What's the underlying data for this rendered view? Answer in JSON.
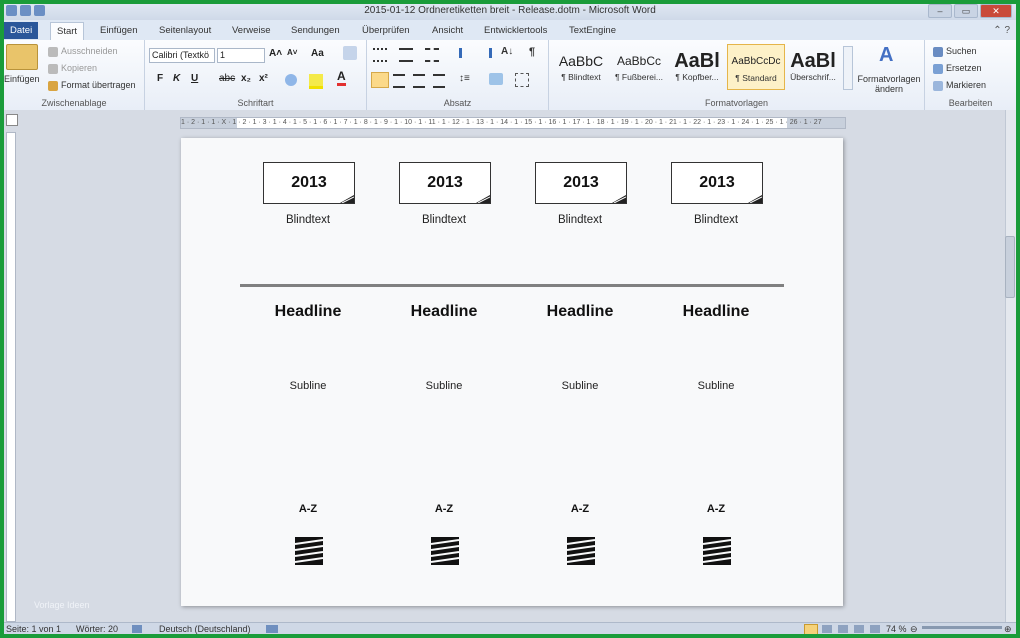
{
  "window": {
    "title": "2015-01-12 Ordneretiketten breit - Release.dotm - Microsoft Word"
  },
  "tabs": [
    {
      "label": "Datei"
    },
    {
      "label": "Start"
    },
    {
      "label": "Einfügen"
    },
    {
      "label": "Seitenlayout"
    },
    {
      "label": "Verweise"
    },
    {
      "label": "Sendungen"
    },
    {
      "label": "Überprüfen"
    },
    {
      "label": "Ansicht"
    },
    {
      "label": "Entwicklertools"
    },
    {
      "label": "TextEngine"
    }
  ],
  "ribbon": {
    "clipboard": {
      "paste": "Einfügen",
      "cut": "Ausschneiden",
      "copy": "Kopieren",
      "format_painter": "Format übertragen",
      "label": "Zwischenablage"
    },
    "font": {
      "font_name": "Calibri (Textkö",
      "font_size": "1",
      "bold": "F",
      "italic": "K",
      "underline": "U",
      "strike": "abc",
      "subscript": "x₂",
      "superscript": "x²",
      "grow": "A˄",
      "shrink": "A˅",
      "case": "Aa",
      "label": "Schriftart"
    },
    "paragraph": {
      "label": "Absatz"
    },
    "styles": {
      "items": [
        {
          "sample": "AaBbC",
          "name": "¶ Blindtext"
        },
        {
          "sample": "AaBbCc",
          "name": "¶ Fußberei..."
        },
        {
          "sample": "AaBl",
          "name": "¶ Kopfber..."
        },
        {
          "sample": "AaBbCcDc",
          "name": "¶ Standard"
        },
        {
          "sample": "AaBl",
          "name": "Überschrif..."
        }
      ],
      "change": "Formatvorlagen ändern",
      "label": "Formatvorlagen"
    },
    "editing": {
      "find": "Suchen",
      "replace": "Ersetzen",
      "select": "Markieren",
      "label": "Bearbeiten"
    }
  },
  "ruler": {
    "ticks": "1 · 2 · 1 · 1 · X · 1 · 2 · 1 · 3 · 1 · 4 · 1 · 5 · 1 · 6 · 1 · 7 · 1 · 8 · 1 · 9 · 1 · 10 · 1 · 11 · 1 · 12 · 1 · 13 · 1 · 14 · 1 · 15 · 1 · 16 · 1 · 17 · 1 · 18 · 1 · 19 · 1 · 20 · 1 · 21 · 1 · 22 · 1 · 23 · 1 · 24 · 1 · 25 · 1 · 26 · 1 · 27"
  },
  "document": {
    "columns": [
      {
        "year": "2013",
        "blindtext": "Blindtext",
        "headline": "Headline",
        "subline": "Subline",
        "az": "A-Z"
      },
      {
        "year": "2013",
        "blindtext": "Blindtext",
        "headline": "Headline",
        "subline": "Subline",
        "az": "A-Z"
      },
      {
        "year": "2013",
        "blindtext": "Blindtext",
        "headline": "Headline",
        "subline": "Subline",
        "az": "A-Z"
      },
      {
        "year": "2013",
        "blindtext": "Blindtext",
        "headline": "Headline",
        "subline": "Subline",
        "az": "A-Z"
      }
    ]
  },
  "watermark": "Vorlage Ideen",
  "statusbar": {
    "page": "Seite: 1 von 1",
    "words": "Wörter: 20",
    "language": "Deutsch (Deutschland)",
    "zoom": "74 %"
  },
  "colors": {
    "file_tab": "#2b579a",
    "outer_frame": "#1a9c3a",
    "selected_style": "#fdf1c8"
  }
}
